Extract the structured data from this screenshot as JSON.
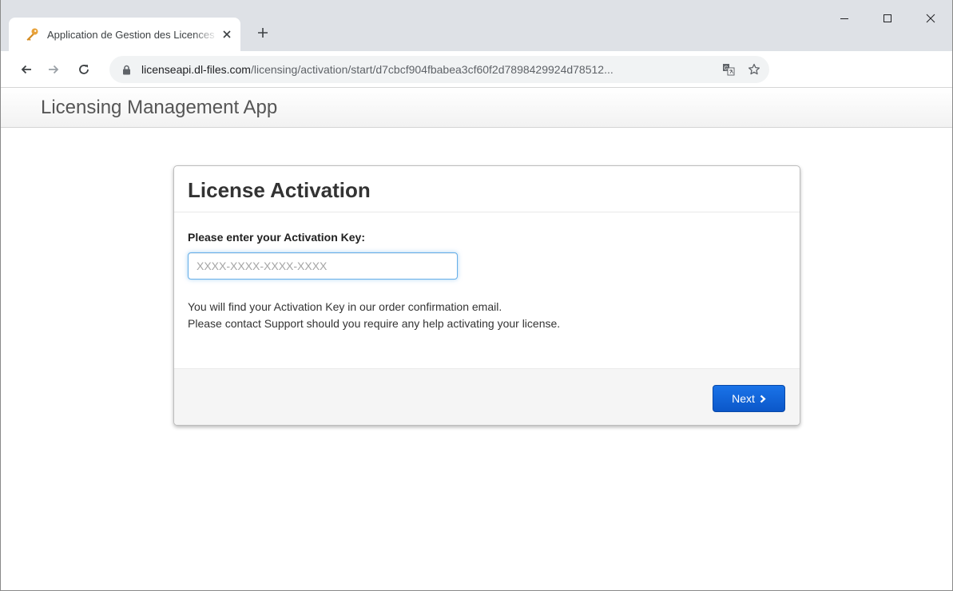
{
  "browser": {
    "tab": {
      "title": "Application de Gestion des Licences",
      "favicon": "key-icon",
      "favicon_color": "#e8a23a"
    },
    "address": {
      "host": "licenseapi.dl-files.com",
      "path": "/licensing/activation/start/d7cbcf904fbabea3cf60f2d7898429924d78512..."
    },
    "icons": [
      "back-icon",
      "forward-icon",
      "reload-icon",
      "lock-icon",
      "translate-icon",
      "star-icon",
      "close-icon",
      "plus-icon",
      "minimize-icon",
      "maximize-icon"
    ]
  },
  "app": {
    "brand": "Licensing Management App"
  },
  "panel": {
    "title": "License Activation",
    "field_label": "Please enter your Activation Key:",
    "input_placeholder": "XXXX-XXXX-XXXX-XXXX",
    "input_value": "",
    "help_line1": "You will find your Activation Key in our order confirmation email.",
    "help_line2": "Please contact Support should you require any help activating your license.",
    "next_label": "Next",
    "accent": "#1a73e8"
  }
}
